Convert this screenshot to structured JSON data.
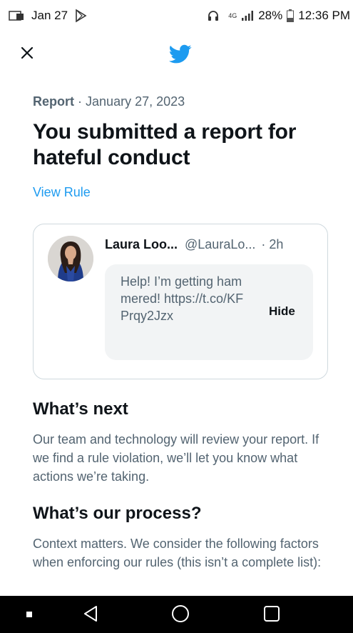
{
  "status_bar": {
    "date": "Jan 27",
    "network": "4G",
    "battery": "28%",
    "time": "12:36 PM"
  },
  "header": {
    "close_icon": "close-icon",
    "logo_icon": "twitter-bird-icon",
    "brand_color": "#1d9bf0"
  },
  "report": {
    "label": "Report",
    "separator": "·",
    "date": "January 27, 2023",
    "title": "You submitted a report for hateful conduct",
    "view_rule": "View Rule"
  },
  "tweet": {
    "name": "Laura Loo...",
    "handle": "@LauraLo...",
    "time": "· 2h",
    "text": "Help! I’m getting hammered! https://t.co/KFPrqy2Jzx",
    "hide_label": "Hide"
  },
  "sections": [
    {
      "heading": "What’s next",
      "body": "Our team and technology will review your report. If we find a rule violation, we’ll let you know what actions we’re taking."
    },
    {
      "heading": "What’s our process?",
      "body": "Context matters. We consider the following factors when enforcing our rules (this isn’t a complete list):"
    }
  ],
  "nav": {
    "items": [
      "recents-icon",
      "back-icon",
      "home-icon",
      "overview-icon"
    ]
  }
}
